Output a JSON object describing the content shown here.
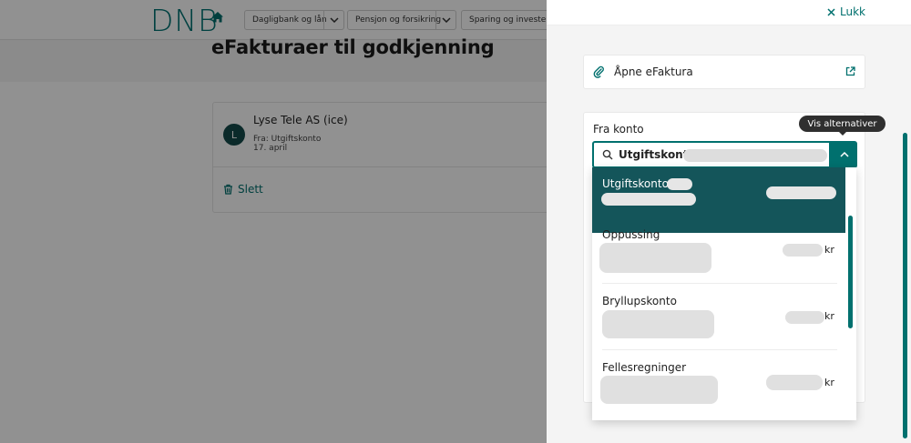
{
  "header": {
    "logo": "DNB",
    "home_icon": "home-icon",
    "nav": [
      {
        "label": "Dagligbank og lån"
      },
      {
        "label": "Pensjon og forsikring"
      },
      {
        "label": "Sparing og investering"
      }
    ]
  },
  "page": {
    "title": "eFakturaer til godkjenning"
  },
  "invoice": {
    "avatar_letter": "L",
    "payee": "Lyse Tele AS (ice)",
    "from_prefix": "Fra: Utgiftskonto",
    "date": "17. april",
    "delete_label": "Slett"
  },
  "drawer": {
    "close_label": "Lukk",
    "open_efaktura_label": "Åpne eFaktura",
    "from_account_label": "Fra konto",
    "selected_account": "Utgiftskonto",
    "tooltip": "Vis alternativer",
    "accounts": [
      {
        "name": "Utgiftskonto",
        "currency": "",
        "selected": true
      },
      {
        "name": "Oppussing",
        "currency": "kr",
        "selected": false
      },
      {
        "name": "Bryllupskonto",
        "currency": "kr",
        "selected": false
      },
      {
        "name": "Fellesregninger",
        "currency": "kr",
        "selected": false
      }
    ]
  },
  "colors": {
    "accent": "#00706e",
    "selected_row": "#14555a"
  }
}
